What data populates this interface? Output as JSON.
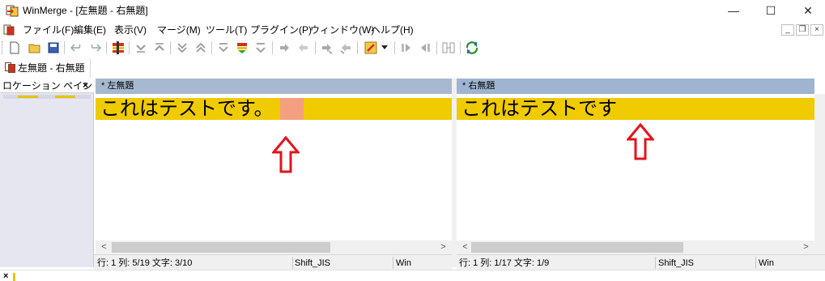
{
  "window": {
    "title": "WinMerge - [左無題 - 右無題]",
    "controls": {
      "minimize": "—",
      "maximize": "☐",
      "close": "✕"
    }
  },
  "menu": {
    "items": [
      "ファイル(F)",
      "編集(E)",
      "表示(V)",
      "マージ(M)",
      "ツール(T)",
      "プラグイン(P)",
      "ウィンドウ(W)",
      "ヘルプ(H)"
    ],
    "mdi_controls": {
      "minimize": "_",
      "restore": "❐",
      "close": "×"
    }
  },
  "toolbar": {
    "icons": [
      "new-icon",
      "open-icon",
      "save-icon",
      "undo-icon",
      "redo-icon",
      "options-icon",
      "next-diff-icon",
      "prev-diff-icon",
      "first-diff-icon",
      "last-diff-icon",
      "current-diff-icon",
      "next-conflict-icon",
      "prev-conflict-icon",
      "copy-right-icon",
      "copy-left-icon",
      "copy-right-advance-icon",
      "copy-left-advance-icon",
      "auto-merge-icon",
      "dropdown-icon",
      "next-file-icon",
      "prev-file-icon",
      "compare-icon",
      "refresh-icon"
    ]
  },
  "tabs": [
    {
      "label": "左無題 - 右無題"
    }
  ],
  "location_pane": {
    "title": "ロケーション ペイン",
    "close": "×"
  },
  "left_pane": {
    "header": "* 左無題",
    "line_text": "これはテストです",
    "line_extra": "。",
    "status": {
      "position": "行: 1  列: 5/19  文字: 3/10",
      "encoding": "Shift_JIS",
      "eol": "Win"
    }
  },
  "right_pane": {
    "header": "* 右無題",
    "line_text": "これはテストです",
    "status": {
      "position": "行: 1  列: 1/17  文字: 1/9",
      "encoding": "Shift_JIS",
      "eol": "Win"
    }
  },
  "scrollbar": {
    "left_arrow": "<",
    "right_arrow": ">"
  },
  "colors": {
    "diff_line": "#efcb00",
    "diff_word": "#f4a080",
    "pane_header_left": "#a7b9d0",
    "pane_header_right": "#9fb4d0",
    "arrow": "#e0141e"
  },
  "bottom": {
    "close": "×"
  }
}
